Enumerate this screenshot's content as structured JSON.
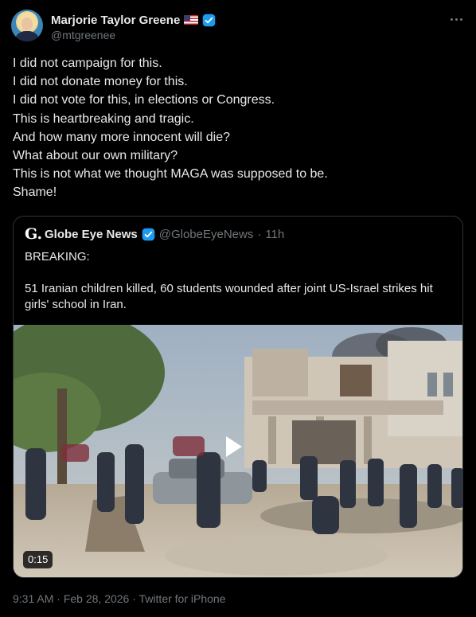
{
  "author": {
    "display_name": "Marjorie Taylor Greene",
    "handle": "@mtgreenee",
    "avatar_icon": "profile-photo",
    "flag_icon": "us-flag-icon",
    "verified_color": "#1d9bf0"
  },
  "tweet": {
    "lines": [
      "I did not campaign for this.",
      "I did not donate money for this.",
      "I did not vote for this, in elections or Congress.",
      "This is heartbreaking and tragic.",
      "And how many more innocent will die?",
      "What about our own military?",
      "This is not what we thought MAGA was supposed to be.",
      "Shame!"
    ]
  },
  "quote": {
    "logo_text": "G.",
    "name": "Globe Eye News",
    "handle": "@GlobeEyeNews",
    "separator": "·",
    "time": "11h",
    "paragraph_1": "BREAKING:",
    "paragraph_2": "51 Iranian children killed, 60 students wounded after joint US-Israel strikes hit girls' school in Iran.",
    "video_duration": "0:15"
  },
  "footer": {
    "time": "9:31 AM",
    "date": "Feb 28, 2026",
    "source": "Twitter for iPhone",
    "separator": "·"
  },
  "colors": {
    "background": "#000000",
    "text": "#e7e9ea",
    "muted": "#71767b",
    "border": "#2f3336",
    "verified": "#1d9bf0"
  }
}
